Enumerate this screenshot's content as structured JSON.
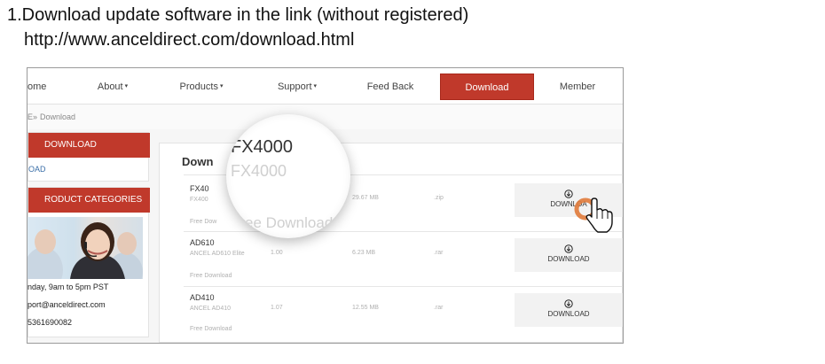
{
  "instructions": {
    "line1": "1.Download update software in the link (without registered)",
    "line2": "http://www.anceldirect.com/download.html"
  },
  "nav": {
    "items": [
      {
        "label": "ome",
        "dropdown": false
      },
      {
        "label": "About",
        "dropdown": true
      },
      {
        "label": "Products",
        "dropdown": true
      },
      {
        "label": "Support",
        "dropdown": true
      },
      {
        "label": "Feed Back",
        "dropdown": false
      },
      {
        "label": "Download",
        "dropdown": false,
        "active": true
      },
      {
        "label": "Member",
        "dropdown": false
      }
    ],
    "accent": "#c0392b"
  },
  "breadcrumb": {
    "home": "E",
    "sep": "»",
    "current": "Download"
  },
  "sidebar": {
    "download_header": "DOWNLOAD",
    "download_link": "OAD",
    "categories_header": "RODUCT CATEGORIES",
    "contact": {
      "hours": "nday, 9am to 5pm PST",
      "email": "port@anceldirect.com",
      "phone": "5361690082"
    }
  },
  "main": {
    "title": "Down",
    "products": [
      {
        "name": "FX40",
        "subtitle": "FX400",
        "version": "",
        "size": "29.67 MB",
        "ext": ".zip",
        "free_label": "Free Dow",
        "button_label": "DOWNLOA"
      },
      {
        "name": "AD610",
        "subtitle": "ANCEL AD610 Elite",
        "version": "1.00",
        "size": "6.23 MB",
        "ext": ".rar",
        "free_label": "Free Download",
        "button_label": "DOWNLOAD"
      },
      {
        "name": "AD410",
        "subtitle": "ANCEL AD410",
        "version": "1.07",
        "size": "12.55 MB",
        "ext": ".rar",
        "free_label": "Free Download",
        "button_label": "DOWNLOAD"
      }
    ]
  },
  "magnifier": {
    "name": "FX4000",
    "subtitle": "FX4000",
    "free_label": "Free Download"
  },
  "icons": [
    "download-icon",
    "hand-cursor-icon",
    "caret-down-icon",
    "agent-photo"
  ]
}
